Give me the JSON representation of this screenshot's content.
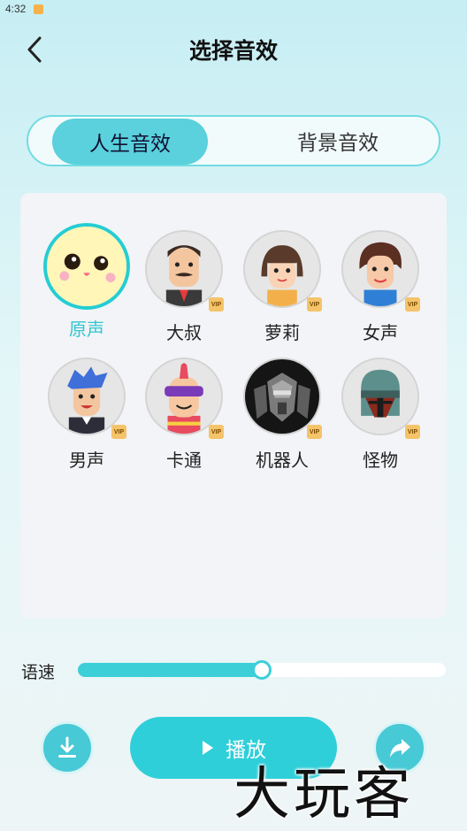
{
  "status_bar": {
    "time": "4:32"
  },
  "header": {
    "title": "选择音效"
  },
  "tabs": [
    {
      "label": "人生音效",
      "active": true
    },
    {
      "label": "背景音效",
      "active": false
    }
  ],
  "effects": [
    {
      "label": "原声",
      "icon": "cute-face-icon",
      "vip": false,
      "selected": true
    },
    {
      "label": "大叔",
      "icon": "uncle-avatar-icon",
      "vip": true,
      "selected": false
    },
    {
      "label": "萝莉",
      "icon": "girl-avatar-icon",
      "vip": true,
      "selected": false
    },
    {
      "label": "女声",
      "icon": "woman-avatar-icon",
      "vip": true,
      "selected": false
    },
    {
      "label": "男声",
      "icon": "man-avatar-icon",
      "vip": true,
      "selected": false
    },
    {
      "label": "卡通",
      "icon": "cartoon-avatar-icon",
      "vip": true,
      "selected": false
    },
    {
      "label": "机器人",
      "icon": "robot-avatar-icon",
      "vip": true,
      "selected": false
    },
    {
      "label": "怪物",
      "icon": "monster-avatar-icon",
      "vip": true,
      "selected": false
    }
  ],
  "vip_badge": "VIP",
  "speed": {
    "label": "语速",
    "value_fraction": 0.5
  },
  "actions": {
    "play_label": "播放"
  },
  "watermark": "大玩客",
  "colors": {
    "accent": "#2ecfd9",
    "selected_label": "#30c6d2",
    "vip": "#f4c36a"
  }
}
